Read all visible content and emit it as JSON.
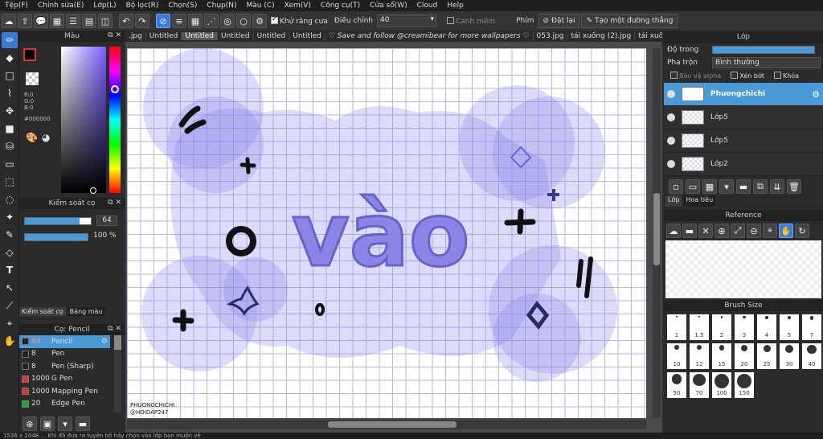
{
  "menu": [
    "Tệp(F)",
    "Chỉnh sửa(E)",
    "Lớp(L)",
    "Bộ lọc(R)",
    "Chọn(S)",
    "Chụp(N)",
    "Màu (C)",
    "Xem(V)",
    "Công cụ(T)",
    "Cửa sổ(W)",
    "Cloud",
    "Help"
  ],
  "toolbar": {
    "antialias_label": "Khử răng cưa",
    "correction_label": "Điều chỉnh",
    "correction_value": "40",
    "smooth_label": "Cạnh mềm",
    "keys_label": "Phím",
    "reset_label": "Đặt lại",
    "straight_label": "Tạo một đường thẳng"
  },
  "color_panel": {
    "title": "Màu",
    "r": "R:0",
    "g": "G:0",
    "b": "B:0",
    "hex": "#000000"
  },
  "brush_control": {
    "title": "Kiểm soát cọ",
    "size": "64",
    "opacity": "100 %",
    "tab1": "Kiểm soát cọ",
    "tab2": "Bảng màu"
  },
  "brush_list": {
    "title": "Cọ: Pencil",
    "items": [
      {
        "size": "64",
        "name": "Pencil",
        "color": "#222222"
      },
      {
        "size": "8",
        "name": "Pen",
        "color": "#222222"
      },
      {
        "size": "8",
        "name": "Pen (Sharp)",
        "color": "#222222"
      },
      {
        "size": "1000",
        "name": "G Pen",
        "color": "#e03030"
      },
      {
        "size": "1000",
        "name": "Mapping Pen",
        "color": "#e03030"
      },
      {
        "size": "20",
        "name": "Edge Pen",
        "color": "#22aa22"
      }
    ]
  },
  "tabs": [
    ".jpg",
    "Untitled",
    "Untitled",
    "Untitled",
    "Untitled",
    "Untitled",
    "♡ Save and follow @creamibear for more wallpapers ♡",
    "053.jpg",
    "tải xuống (2).jpg",
    "tải xuống (3).jpg",
    "Untitled",
    "Untitled"
  ],
  "canvas": {
    "main_text": "vào",
    "signature1": "PHUONGCHICHI",
    "signature2": "@HOIDAP247"
  },
  "layers": {
    "title": "Lớp",
    "opacity_label": "Độ trong",
    "blend_label": "Pha trộn",
    "blend_value": "Bình thường",
    "protect_alpha": "Bảo vệ alpha",
    "clipping": "Xén bớt",
    "lock": "Khóa",
    "items": [
      "Phuongchichi",
      "Lớp5",
      "Lớp5",
      "Lớp2"
    ],
    "tab1": "Lớp",
    "tab2": "Hoa tiêu"
  },
  "reference": {
    "title": "Reference"
  },
  "brush_size": {
    "title": "Brush Size",
    "values": [
      "1",
      "1.5",
      "2",
      "3",
      "4",
      "5",
      "7",
      "10",
      "12",
      "15",
      "20",
      "25",
      "30",
      "40",
      "50",
      "70",
      "100",
      "150"
    ]
  },
  "statusbar": "1536 x 2048 ... Khi đã đưa ra tuyên bố hãy chọn vào lớp bạn muốn vẽ"
}
